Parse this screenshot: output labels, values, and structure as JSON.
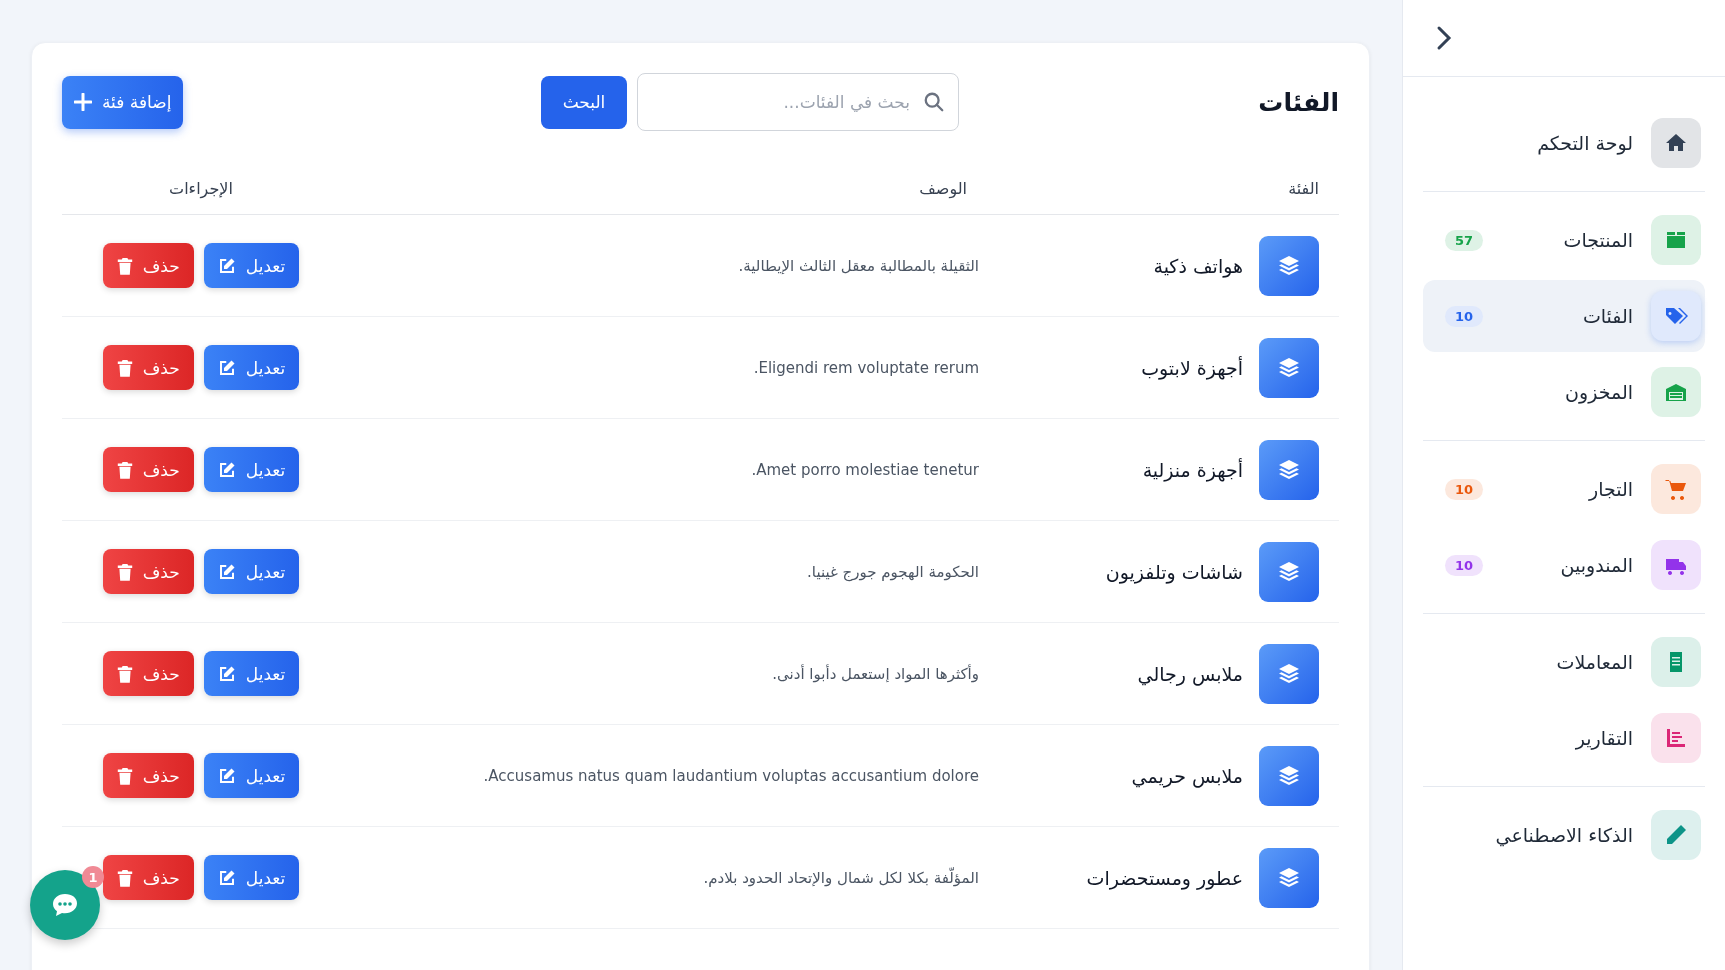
{
  "sidebar": {
    "groups": [
      [
        {
          "label": "لوحة التحكم",
          "selected": false,
          "color": "#334155"
        }
      ],
      [
        {
          "label": "المنتجات",
          "badge": "57",
          "selected": false,
          "color": "#16a34a"
        },
        {
          "label": "الفئات",
          "badge": "10",
          "selected": true,
          "color": "#2563eb"
        },
        {
          "label": "المخزون",
          "selected": false,
          "color": "#16a34a"
        }
      ],
      [
        {
          "label": "التجار",
          "badge": "10",
          "selected": false,
          "color": "#ea580c"
        },
        {
          "label": "المندوبين",
          "badge": "10",
          "selected": false,
          "color": "#9333ea"
        }
      ],
      [
        {
          "label": "المعاملات",
          "selected": false,
          "color": "#059669"
        },
        {
          "label": "التقارير",
          "selected": false,
          "color": "#db2777"
        }
      ],
      [
        {
          "label": "الذكاء الاصطناعي",
          "selected": false,
          "color": "#0d9488"
        }
      ]
    ]
  },
  "page": {
    "title": "الفئات",
    "search": {
      "placeholder": "بحث في الفئات..."
    },
    "search_button": "البحث",
    "add_button": "إضافة فئة"
  },
  "table": {
    "columns": [
      "الفئة",
      "الوصف",
      "الإجراءات"
    ],
    "rows": [
      {
        "name": "هواتف ذكية",
        "description": "الثقيلة بالمطالبة معقل الثالث الإيطالية.",
        "edit": "تعديل",
        "delete": "حذف"
      },
      {
        "name": "أجهزة لابتوب",
        "description": "Eligendi rem voluptate rerum.",
        "edit": "تعديل",
        "delete": "حذف"
      },
      {
        "name": "أجهزة منزلية",
        "description": "Amet porro molestiae tenetur.",
        "edit": "تعديل",
        "delete": "حذف"
      },
      {
        "name": "شاشات وتلفزيون",
        "description": "الحكومة الهجوم جورج غينيا.",
        "edit": "تعديل",
        "delete": "حذف"
      },
      {
        "name": "ملابس رجالي",
        "description": "وأكثرها المواد إستعمل دأبوا أدنى.",
        "edit": "تعديل",
        "delete": "حذف"
      },
      {
        "name": "ملابس حريمي",
        "description": "Accusamus natus quam laudantium voluptas accusantium dolore.",
        "edit": "تعديل",
        "delete": "حذف"
      },
      {
        "name": "عطور ومستحضرات",
        "description": "المؤلّفة بكلا لكل شمال والإتحاد الحدود بلادم.",
        "edit": "تعديل",
        "delete": "حذف"
      }
    ]
  },
  "chat": {
    "badge": "1"
  }
}
